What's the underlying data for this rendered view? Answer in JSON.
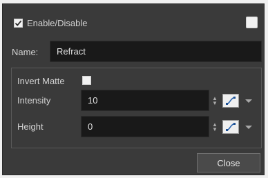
{
  "enable": {
    "label": "Enable/Disable",
    "checked": true
  },
  "color_swatch": {
    "color": "#f2f2f2"
  },
  "name": {
    "label": "Name:",
    "value": "Refract"
  },
  "invert_matte": {
    "label": "Invert Matte",
    "checked": false
  },
  "intensity": {
    "label": "Intensity",
    "value": "10"
  },
  "height": {
    "label": "Height",
    "value": "0"
  },
  "close_button": {
    "label": "Close"
  },
  "icons": {
    "spinner": "up-down-arrows-icon",
    "function_curve": "function-curve-icon",
    "dropdown": "chevron-down-icon"
  }
}
